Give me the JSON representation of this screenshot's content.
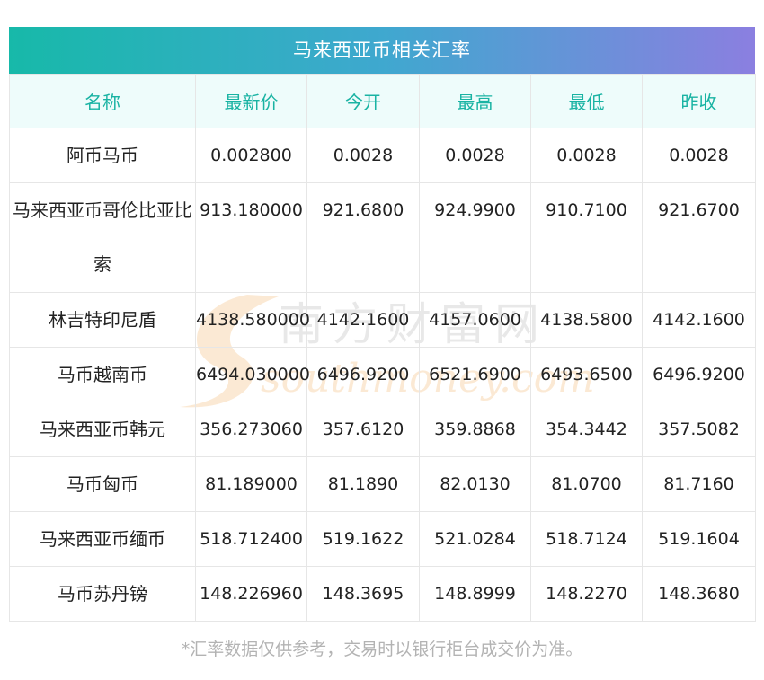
{
  "table": {
    "title": "马来西亚币相关汇率",
    "headers": [
      "名称",
      "最新价",
      "今开",
      "最高",
      "最低",
      "昨收"
    ],
    "rows": [
      [
        "阿币马币",
        "0.002800",
        "0.0028",
        "0.0028",
        "0.0028",
        "0.0028"
      ],
      [
        "马来西亚币哥伦比亚比索",
        "913.180000",
        "921.6800",
        "924.9900",
        "910.7100",
        "921.6700"
      ],
      [
        "林吉特印尼盾",
        "4138.580000",
        "4142.1600",
        "4157.0600",
        "4138.5800",
        "4142.1600"
      ],
      [
        "马币越南币",
        "6494.030000",
        "6496.9200",
        "6521.6900",
        "6493.6500",
        "6496.9200"
      ],
      [
        "马来西亚币韩元",
        "356.273060",
        "357.6120",
        "359.8868",
        "354.3442",
        "357.5082"
      ],
      [
        "马币匈币",
        "81.189000",
        "81.1890",
        "82.0130",
        "81.0700",
        "81.7160"
      ],
      [
        "马来西亚币缅币",
        "518.712400",
        "519.1622",
        "521.0284",
        "518.7124",
        "519.1604"
      ],
      [
        "马币苏丹镑",
        "148.226960",
        "148.3695",
        "148.8999",
        "148.2270",
        "148.3680"
      ]
    ]
  },
  "note": "*汇率数据仅供参考，交易时以银行柜台成交价为准。",
  "watermark": {
    "cn": "南方财富网",
    "en": "southmoney.com"
  },
  "colors": {
    "header_text": "#19b3a3",
    "header_bg": "#eefcfb",
    "title_grad_start": "#17b9a9",
    "title_grad_end": "#8b7fe0"
  }
}
